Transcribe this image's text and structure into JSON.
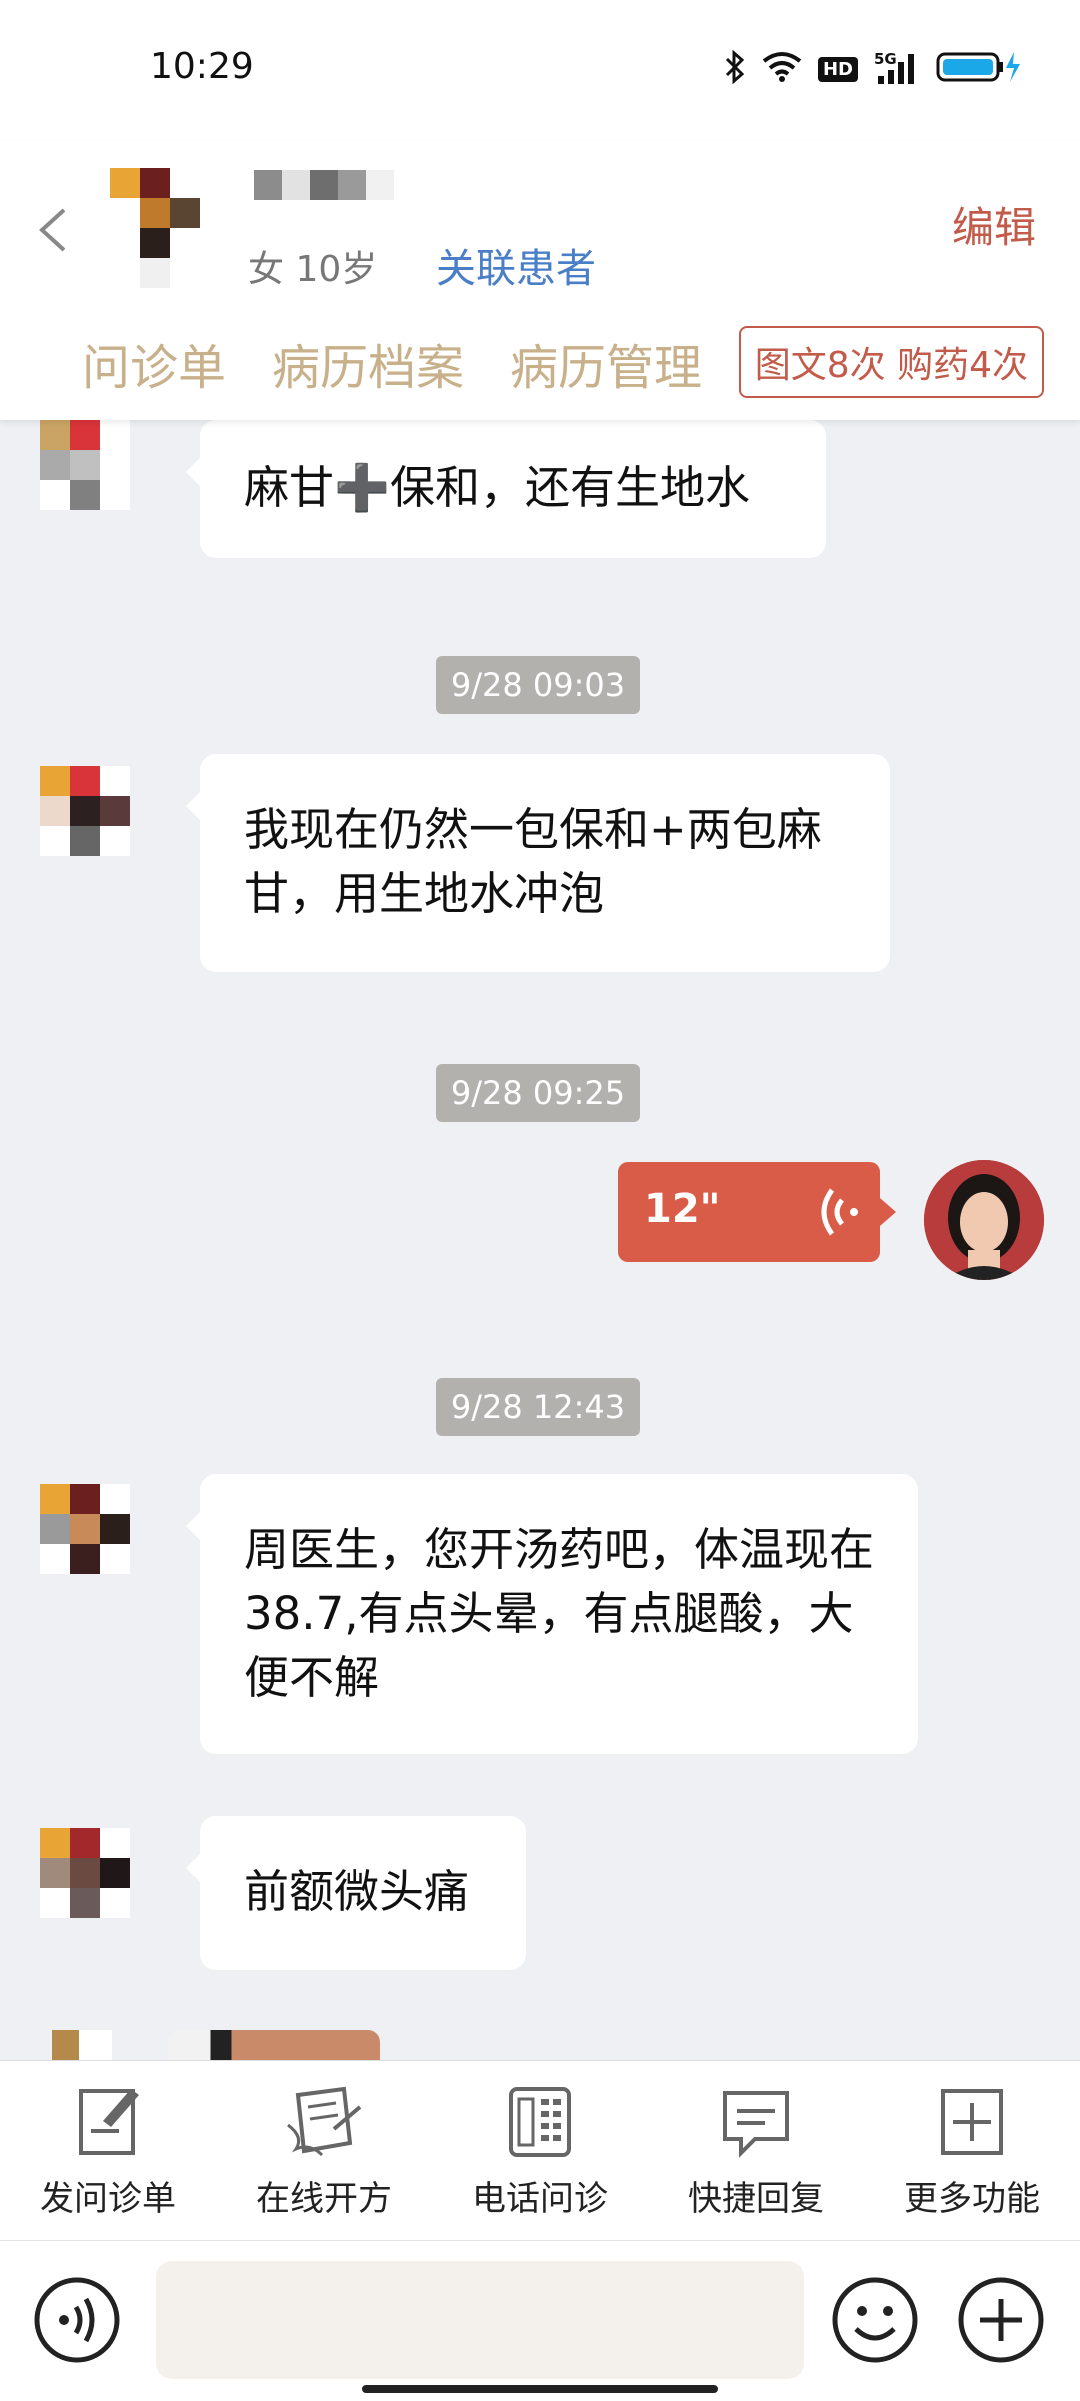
{
  "status_bar": {
    "time": "10:29",
    "icons": [
      "bluetooth-icon",
      "wifi-icon",
      "hd-icon",
      "5g-signal-icon",
      "battery-charging-icon"
    ],
    "network": "5G",
    "hd": "HD"
  },
  "header": {
    "patient_info": "女 10岁",
    "link_patient_label": "关联患者",
    "edit_label": "编辑",
    "tabs": [
      {
        "label": "问诊单"
      },
      {
        "label": "病历档案"
      },
      {
        "label": "病历管理"
      }
    ],
    "quota_label": "图文8次 购药4次"
  },
  "chat": {
    "messages": [
      {
        "from": "patient",
        "text": "麻甘➕保和，还有生地水"
      },
      {
        "timestamp": "9/28 09:03"
      },
      {
        "from": "patient",
        "text": "我现在仍然一包保和+两包麻甘，用生地水冲泡"
      },
      {
        "timestamp": "9/28 09:25"
      },
      {
        "from": "doctor",
        "type": "voice",
        "duration": "12\""
      },
      {
        "timestamp": "9/28 12:43"
      },
      {
        "from": "patient",
        "text": "周医生，您开汤药吧，体温现在38.7,有点头晕，有点腿酸，大便不解"
      },
      {
        "from": "patient",
        "text": "前额微头痛"
      }
    ]
  },
  "toolbar": {
    "items": [
      {
        "label": "发问诊单",
        "icon": "form-edit-icon"
      },
      {
        "label": "在线开方",
        "icon": "prescription-icon"
      },
      {
        "label": "电话问诊",
        "icon": "phone-icon"
      },
      {
        "label": "快捷回复",
        "icon": "chat-reply-icon"
      },
      {
        "label": "更多功能",
        "icon": "plus-square-icon"
      }
    ]
  },
  "input_bar": {
    "text_value": "",
    "icons": [
      "voice-input-icon",
      "emoji-icon",
      "add-icon"
    ]
  },
  "colors": {
    "accent_red": "#d85c48",
    "link_blue": "#4a7fc8",
    "tab_gold": "#c8b08a",
    "chat_bg": "#eef0f4"
  }
}
